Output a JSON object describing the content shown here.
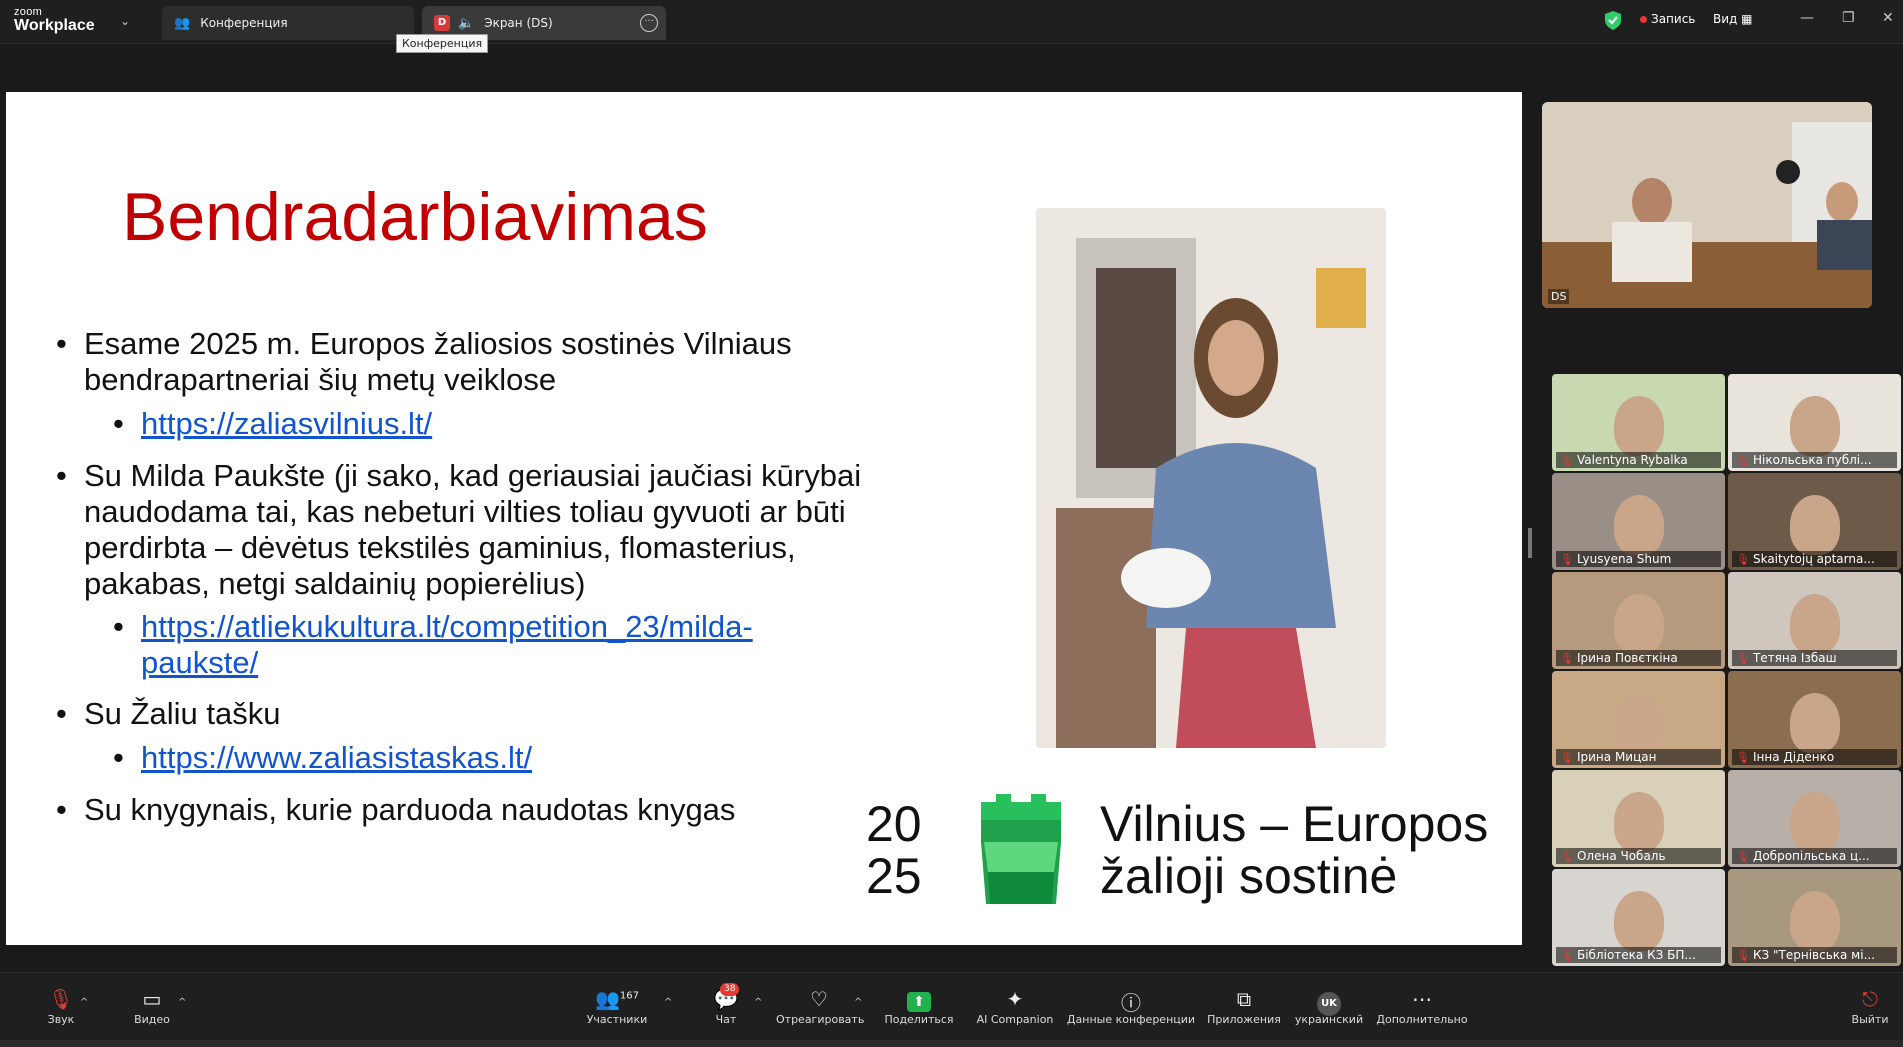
{
  "app": {
    "brand_small": "zoom",
    "brand_big": "Workplace"
  },
  "tabs": [
    {
      "label": "Конференция"
    },
    {
      "badge": "D",
      "label": "Экран (DS)"
    }
  ],
  "tooltip": "Конференция",
  "topright": {
    "record": "Запись",
    "view": "Вид"
  },
  "slide": {
    "title": "Bendradarbiavimas",
    "b1": "Esame 2025 m. Europos žaliosios sostinės Vilniaus bendrapartneriai šių metų veiklose",
    "b1_link": "https://zaliasvilnius.lt/",
    "b2": "Su Milda Paukšte (ji sako, kad geriausiai jaučiasi kūrybai naudodama tai, kas nebeturi vilties toliau gyvuoti ar būti perdirbta – dėvėtus tekstilės gaminius, flomasterius, pakabas, netgi saldainių popierėlius)",
    "b2_link": "https://atliekukultura.lt/competition_23/milda-paukste/",
    "b3": "Su Žaliu tašku",
    "b3_link": "https://www.zaliasistaskas.lt/",
    "b4": "Su knygynais, kurie parduoda naudotas knygas",
    "logo_num": "20\n25",
    "logo_line1": "Vilnius – Europos",
    "logo_line2": "žalioji sostinė"
  },
  "active_speaker": {
    "name": "DS"
  },
  "participants": [
    {
      "name": "Valentyna Rybalka",
      "bg": "#c8d8b0"
    },
    {
      "name": "Нікольська публі...",
      "bg": "#e8e4dc"
    },
    {
      "name": "Lyusyena Shum",
      "bg": "#9a8f86"
    },
    {
      "name": "Skaitytojų aptarna...",
      "bg": "#6d5a48"
    },
    {
      "name": "Ірина Повєткіна",
      "bg": "#b59a7e"
    },
    {
      "name": "Тетяна Ізбаш",
      "bg": "#cfc7bd"
    },
    {
      "name": "Ірина Мицан",
      "bg": "#c8a885"
    },
    {
      "name": "Інна Діденко",
      "bg": "#8b6d50"
    },
    {
      "name": "Олена Чобаль",
      "bg": "#d8d0b8"
    },
    {
      "name": "Добропільська ц...",
      "bg": "#b8b0a8"
    },
    {
      "name": "Бібліотека КЗ БП...",
      "bg": "#d8d4cf"
    },
    {
      "name": "КЗ \"Тернівська мі...",
      "bg": "#a89880"
    }
  ],
  "toolbar": {
    "sound": "Звук",
    "video": "Видео",
    "participants": "Участники",
    "participants_count": "167",
    "chat": "Чат",
    "chat_badge": "38",
    "react": "Отреагировать",
    "share": "Поделиться",
    "ai": "AI Companion",
    "info": "Данные конференции",
    "apps": "Приложения",
    "lang_code": "UK",
    "lang": "украинский",
    "more": "Дополнительно",
    "leave": "Выйти"
  }
}
